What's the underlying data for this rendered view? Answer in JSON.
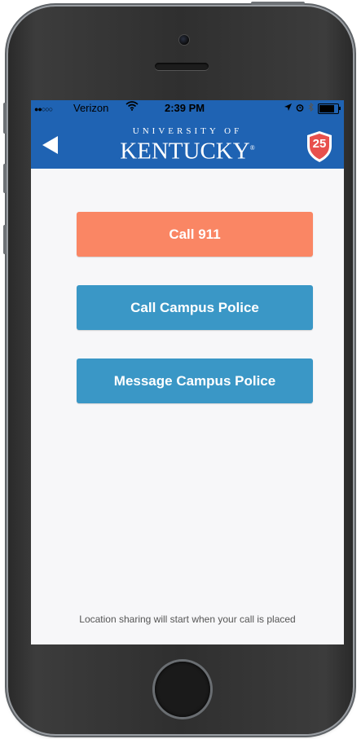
{
  "status_bar": {
    "carrier": "Verizon",
    "time": "2:39 PM",
    "signal_icon": "signal-dots-icon",
    "wifi_icon": "wifi-icon",
    "battery_level": 0.8
  },
  "header": {
    "back_icon": "back-arrow-icon",
    "logo_top": "UNIVERSITY OF",
    "logo_main": "KENTUCKY",
    "logo_mark": "®",
    "badge_value": "25",
    "bar_color": "#1f63b3",
    "badge_color": "#e8504d"
  },
  "actions": {
    "call_911": "Call 911",
    "call_campus_police": "Call Campus Police",
    "message_campus_police": "Message Campus Police",
    "primary_color": "#fa8664",
    "secondary_color": "#3a97c6"
  },
  "footer": {
    "note": "Location sharing will start when your call is placed"
  }
}
